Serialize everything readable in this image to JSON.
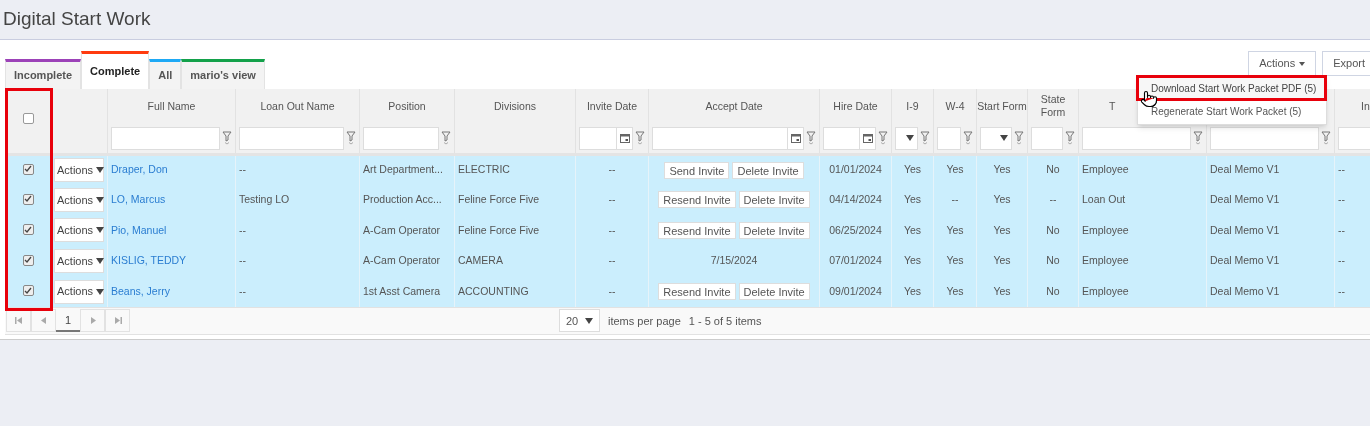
{
  "page_title": "Digital Start Work",
  "toolbar": {
    "buttons": [
      {
        "label": "Actions",
        "kind": "dropdown"
      },
      {
        "label": "Export",
        "kind": "plain"
      }
    ]
  },
  "actions_menu": {
    "items": [
      {
        "label": "Download Start Work Packet PDF (5)",
        "highlighted": true
      },
      {
        "label": "Regenerate Start Work Packet (5)",
        "highlighted": false
      }
    ]
  },
  "tabs": [
    {
      "label": "Incomplete",
      "selected": false,
      "color": "#9c42b8"
    },
    {
      "label": "Complete",
      "selected": true,
      "color": "#ff3b0f"
    },
    {
      "label": "All",
      "selected": false,
      "color": "#1ea9f5"
    },
    {
      "label": "mario's view",
      "selected": false,
      "color": "#13a14a"
    }
  ],
  "table": {
    "select_all_checked": false,
    "columns": [
      {
        "kind": "checkbox"
      },
      {
        "kind": "plain"
      },
      {
        "label": "Full Name",
        "kind": "text"
      },
      {
        "label": "Loan Out Name",
        "kind": "text"
      },
      {
        "label": "Position",
        "kind": "text"
      },
      {
        "label": "Divisions",
        "kind": "plain"
      },
      {
        "label": "Invite Date",
        "kind": "date"
      },
      {
        "label": "Accept Date",
        "kind": "date"
      },
      {
        "label": "Hire Date",
        "kind": "date"
      },
      {
        "label": "I-9",
        "kind": "select"
      },
      {
        "label": "W-4",
        "kind": "text"
      },
      {
        "label": "Start Form",
        "kind": "select"
      },
      {
        "label": "State Form",
        "kind": "text"
      },
      {
        "label": "T",
        "kind": "text"
      },
      {
        "kind": "text"
      },
      {
        "label": "In",
        "kind": "text"
      }
    ],
    "rows": [
      {
        "checked": true,
        "actions": "Actions",
        "full_name": "Draper, Don",
        "loan_out_name": "--",
        "position": "Art Department...",
        "divisions": "ELECTRIC",
        "invite_date": "--",
        "accept_date": {
          "kind": "buttons",
          "buttons": [
            "Send Invite",
            "Delete Invite"
          ]
        },
        "hire_date": "01/01/2024",
        "i_9": "Yes",
        "w_4": "Yes",
        "start_form": "Yes",
        "state_form": "No",
        "type": "Employee",
        "column_15": "Deal Memo V1",
        "column_16": "--"
      },
      {
        "checked": true,
        "actions": "Actions",
        "full_name": "LO, Marcus",
        "loan_out_name": "Testing LO",
        "position": "Production Acc...",
        "divisions": "Feline Force Five",
        "invite_date": "--",
        "accept_date": {
          "kind": "buttons",
          "buttons": [
            "Resend Invite",
            "Delete Invite"
          ]
        },
        "hire_date": "04/14/2024",
        "i_9": "Yes",
        "w_4": "--",
        "start_form": "Yes",
        "state_form": "--",
        "type": "Loan Out",
        "column_15": "Deal Memo V1",
        "column_16": "--"
      },
      {
        "checked": true,
        "actions": "Actions",
        "full_name": "Pio, Manuel",
        "loan_out_name": "--",
        "position": "A-Cam Operator",
        "divisions": "Feline Force Five",
        "invite_date": "--",
        "accept_date": {
          "kind": "buttons",
          "buttons": [
            "Resend Invite",
            "Delete Invite"
          ]
        },
        "hire_date": "06/25/2024",
        "i_9": "Yes",
        "w_4": "Yes",
        "start_form": "Yes",
        "state_form": "No",
        "type": "Employee",
        "column_15": "Deal Memo V1",
        "column_16": "--"
      },
      {
        "checked": true,
        "actions": "Actions",
        "full_name": "KISLIG, TEDDY",
        "loan_out_name": "--",
        "position": "A-Cam Operator",
        "divisions": "CAMERA",
        "invite_date": "--",
        "accept_date": {
          "kind": "text",
          "text": "7/15/2024"
        },
        "hire_date": "07/01/2024",
        "i_9": "Yes",
        "w_4": "Yes",
        "start_form": "Yes",
        "state_form": "No",
        "type": "Employee",
        "column_15": "Deal Memo V1",
        "column_16": "--"
      },
      {
        "checked": true,
        "actions": "Actions",
        "full_name": "Beans, Jerry",
        "loan_out_name": "--",
        "position": "1st Asst Camera",
        "divisions": "ACCOUNTING",
        "invite_date": "--",
        "accept_date": {
          "kind": "buttons",
          "buttons": [
            "Resend Invite",
            "Delete Invite"
          ]
        },
        "hire_date": "09/01/2024",
        "i_9": "Yes",
        "w_4": "Yes",
        "start_form": "Yes",
        "state_form": "No",
        "type": "Employee",
        "column_15": "Deal Memo V1",
        "column_16": "--"
      }
    ]
  },
  "pager": {
    "pages": [
      {
        "label": "1",
        "selected": true
      }
    ],
    "page_size": "20",
    "per_page_label": "items per page",
    "summary": "1 - 5 of 5 items"
  }
}
